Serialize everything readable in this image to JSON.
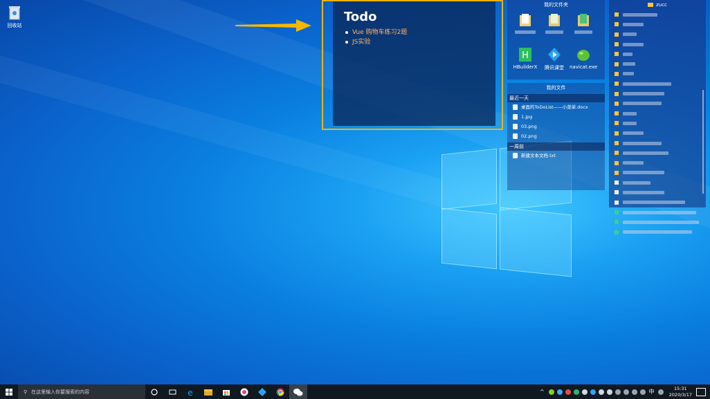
{
  "desktop": {
    "recycle_bin_label": "回收站"
  },
  "todo": {
    "title": "Todo",
    "items": [
      "Vue 购物车练习2题",
      "JS实验"
    ],
    "item_color": "#ffb36b",
    "highlight_color": "#f0b400"
  },
  "folder_panel": {
    "title": "我的文件夹",
    "items": [
      {
        "label": "",
        "icon": "folder-icon"
      },
      {
        "label": "",
        "icon": "folder-icon"
      },
      {
        "label": "",
        "icon": "folder-icon"
      },
      {
        "label": "HBuilderX",
        "icon": "hbuilderx-icon"
      },
      {
        "label": "腾讯课堂",
        "icon": "tencent-classroom-icon"
      },
      {
        "label": "navicat.exe",
        "icon": "navicat-icon"
      }
    ]
  },
  "files_panel": {
    "title": "我的文件",
    "sections": [
      {
        "label": "最近一天",
        "files": [
          "桌面的ToDoList——小菜单.docx",
          "1.jpg",
          "03.png",
          "02.png"
        ]
      },
      {
        "label": "一周前",
        "files": [
          "新建文本文档.txt"
        ]
      }
    ]
  },
  "right_panel": {
    "title": "zucc"
  },
  "taskbar": {
    "search_placeholder": "在这里输入你要搜索的内容",
    "ime_label": "中",
    "time": "15:31",
    "date": "2020/3/17"
  }
}
